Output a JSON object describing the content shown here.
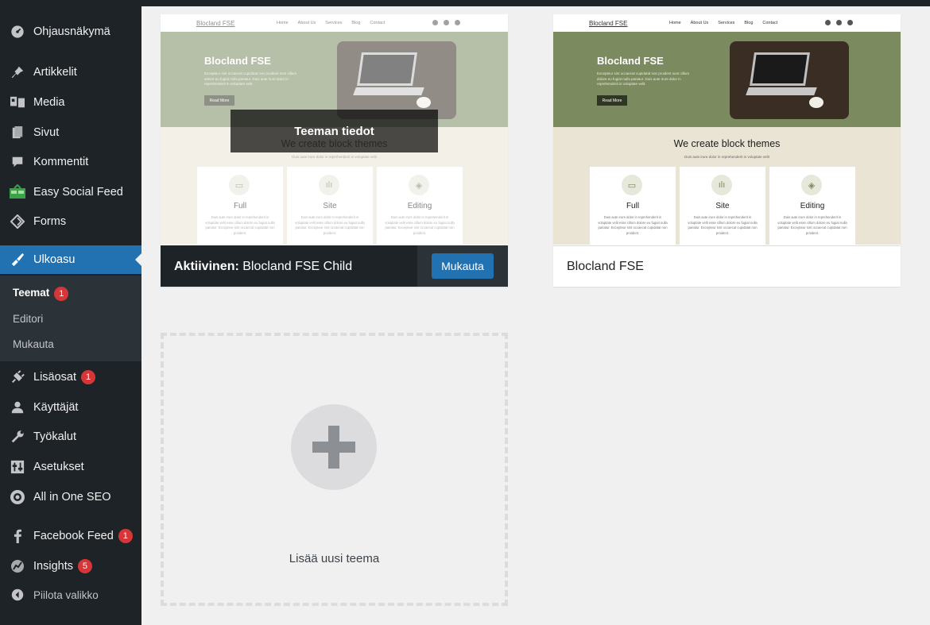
{
  "sidebar": {
    "items": [
      {
        "label": "Ohjausnäkymä",
        "icon": "dashboard-icon"
      },
      {
        "label": "Artikkelit",
        "icon": "pin-icon"
      },
      {
        "label": "Media",
        "icon": "media-icon"
      },
      {
        "label": "Sivut",
        "icon": "pages-icon"
      },
      {
        "label": "Kommentit",
        "icon": "comment-icon"
      },
      {
        "label": "Easy Social Feed",
        "icon": "social-feed-icon"
      },
      {
        "label": "Forms",
        "icon": "forms-icon"
      },
      {
        "label": "Ulkoasu",
        "icon": "appearance-icon"
      },
      {
        "label": "Lisäosat",
        "icon": "plugins-icon",
        "badge": "1"
      },
      {
        "label": "Käyttäjät",
        "icon": "users-icon"
      },
      {
        "label": "Työkalut",
        "icon": "tools-icon"
      },
      {
        "label": "Asetukset",
        "icon": "settings-icon"
      },
      {
        "label": "All in One SEO",
        "icon": "seo-icon"
      },
      {
        "label": "Facebook Feed",
        "icon": "facebook-icon",
        "badge": "1"
      },
      {
        "label": "Insights",
        "icon": "insights-icon",
        "badge": "5"
      }
    ],
    "submenu": [
      {
        "label": "Teemat",
        "badge": "1"
      },
      {
        "label": "Editori"
      },
      {
        "label": "Mukauta"
      }
    ],
    "collapse_label": "Piilota valikko",
    "accent_color": "#2271b1"
  },
  "themes": {
    "active": {
      "prefix": "Aktiivinen:",
      "name": "Blocland FSE Child",
      "customize_label": "Mukauta",
      "details_label": "Teeman tiedot"
    },
    "inactive": {
      "name": "Blocland FSE"
    },
    "preview": {
      "brand": "Blocland FSE",
      "nav_links": [
        "Home",
        "About Us",
        "Services",
        "Blog",
        "Contact"
      ],
      "hero_title": "Blocland FSE",
      "hero_text": "Excepteur sint occaecat cupidatat non proident sunt cillum dolore eu fugiat nulla pariatur. Duis aute irure dolor in reprehenderit in voluptate velit.",
      "hero_button": "Read More",
      "section_title": "We create block themes",
      "section_sub": "Duis aute irure dolor in reprehenderit in voluptate velit",
      "features": [
        {
          "title": "Full",
          "icon": "image-icon"
        },
        {
          "title": "Site",
          "icon": "chart-icon"
        },
        {
          "title": "Editing",
          "icon": "cube-icon"
        }
      ],
      "feature_text": "Duis aute irure dolor in reprehenderit in voluptate velit esse cillum dolore eu fugiat nulla pariatur. Excepteur sint occaecat cupidatat non proident."
    },
    "add_new_label": "Lisää uusi teema"
  }
}
